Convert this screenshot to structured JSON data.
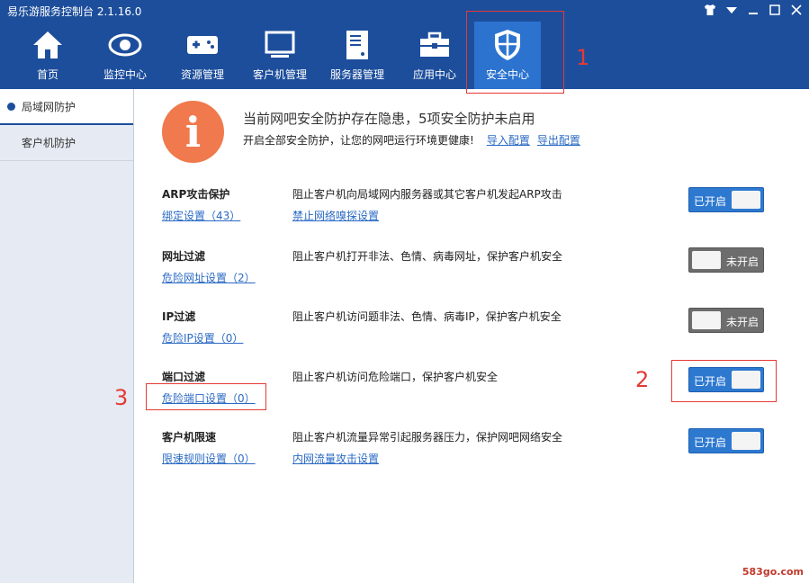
{
  "app": {
    "title": "易乐游服务控制台 2.1.16.0"
  },
  "window_controls": [
    "tshirt-icon",
    "dropdown-icon",
    "minimize-icon",
    "maximize-icon",
    "close-icon"
  ],
  "nav": [
    {
      "label": "首页",
      "icon": "home-icon"
    },
    {
      "label": "监控中心",
      "icon": "eye-icon"
    },
    {
      "label": "资源管理",
      "icon": "gamepad-icon"
    },
    {
      "label": "客户机管理",
      "icon": "monitor-icon"
    },
    {
      "label": "服务器管理",
      "icon": "server-icon"
    },
    {
      "label": "应用中心",
      "icon": "toolbox-icon"
    },
    {
      "label": "安全中心",
      "icon": "shield-icon",
      "active": true
    }
  ],
  "sidebar": {
    "items": [
      {
        "label": "局域网防护",
        "active": true
      },
      {
        "label": "客户机防护",
        "active": false
      }
    ]
  },
  "alert": {
    "icon": "info-icon",
    "title": "当前网吧安全防护存在隐患，5项安全防护未启用",
    "subtitle": "开启全部安全防护，让您的网吧运行环境更健康!",
    "import_link": "导入配置",
    "export_link": "导出配置"
  },
  "protections": [
    {
      "name": "ARP攻击保护",
      "link": "绑定设置（43）",
      "desc": "阻止客户机向局域网内服务器或其它客户机发起ARP攻击",
      "link2": "禁止网络嗅探设置",
      "enabled": true,
      "state_label": "已开启"
    },
    {
      "name": "网址过滤",
      "link": "危险网址设置（2）",
      "desc": "阻止客户机打开非法、色情、病毒网址，保护客户机安全",
      "link2": "",
      "enabled": false,
      "state_label": "未开启"
    },
    {
      "name": "IP过滤",
      "link": "危险IP设置（0）",
      "desc": "阻止客户机访问题非法、色情、病毒IP，保护客户机安全",
      "link2": "",
      "enabled": false,
      "state_label": "未开启"
    },
    {
      "name": "端口过滤",
      "link": "危险端口设置（0）",
      "desc": "阻止客户机访问危险端口，保护客户机安全",
      "link2": "",
      "enabled": true,
      "state_label": "已开启"
    },
    {
      "name": "客户机限速",
      "link": "限速规则设置（0）",
      "desc": "阻止客户机流量异常引起服务器压力，保护网吧网络安全",
      "link2": "内网流量攻击设置",
      "enabled": true,
      "state_label": "已开启"
    }
  ],
  "annotations": [
    {
      "number": "1"
    },
    {
      "number": "2"
    },
    {
      "number": "3"
    }
  ],
  "watermark": "583go.com",
  "colors": {
    "header": "#1d4e9c",
    "nav_active": "#2b73cf",
    "toggle_on": "#2e79d0",
    "toggle_off": "#6d6d6d",
    "alert": "#f07a4d",
    "annotation": "#e53935",
    "link": "#2a6ac4"
  }
}
